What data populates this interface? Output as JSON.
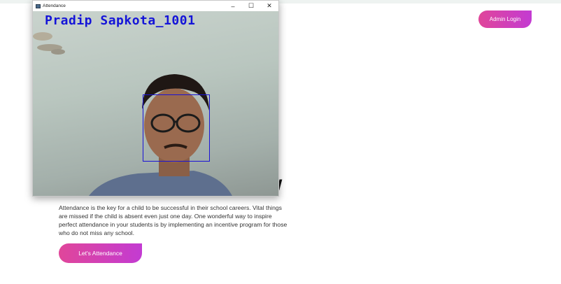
{
  "admin_button": {
    "label": "Admin Login"
  },
  "hero": {
    "heading_visible": "w",
    "description": "Attendance is the key for a child to be successful in their school careers. Vital things are missed if the child is absent even just one day. One wonderful way to inspire perfect attendance in your students is by implementing an incentive program for those who do not miss any school.",
    "cta_label": "Let's Attendance"
  },
  "camera_window": {
    "title": "Attendance",
    "controls": {
      "minimize": "–",
      "maximize": "☐",
      "close": "✕"
    },
    "recognized_name": "Pradip Sapkota_1001"
  },
  "colors": {
    "accent_start": "#e0469a",
    "accent_end": "#c33bd2",
    "face_box": "#1a12d6"
  }
}
